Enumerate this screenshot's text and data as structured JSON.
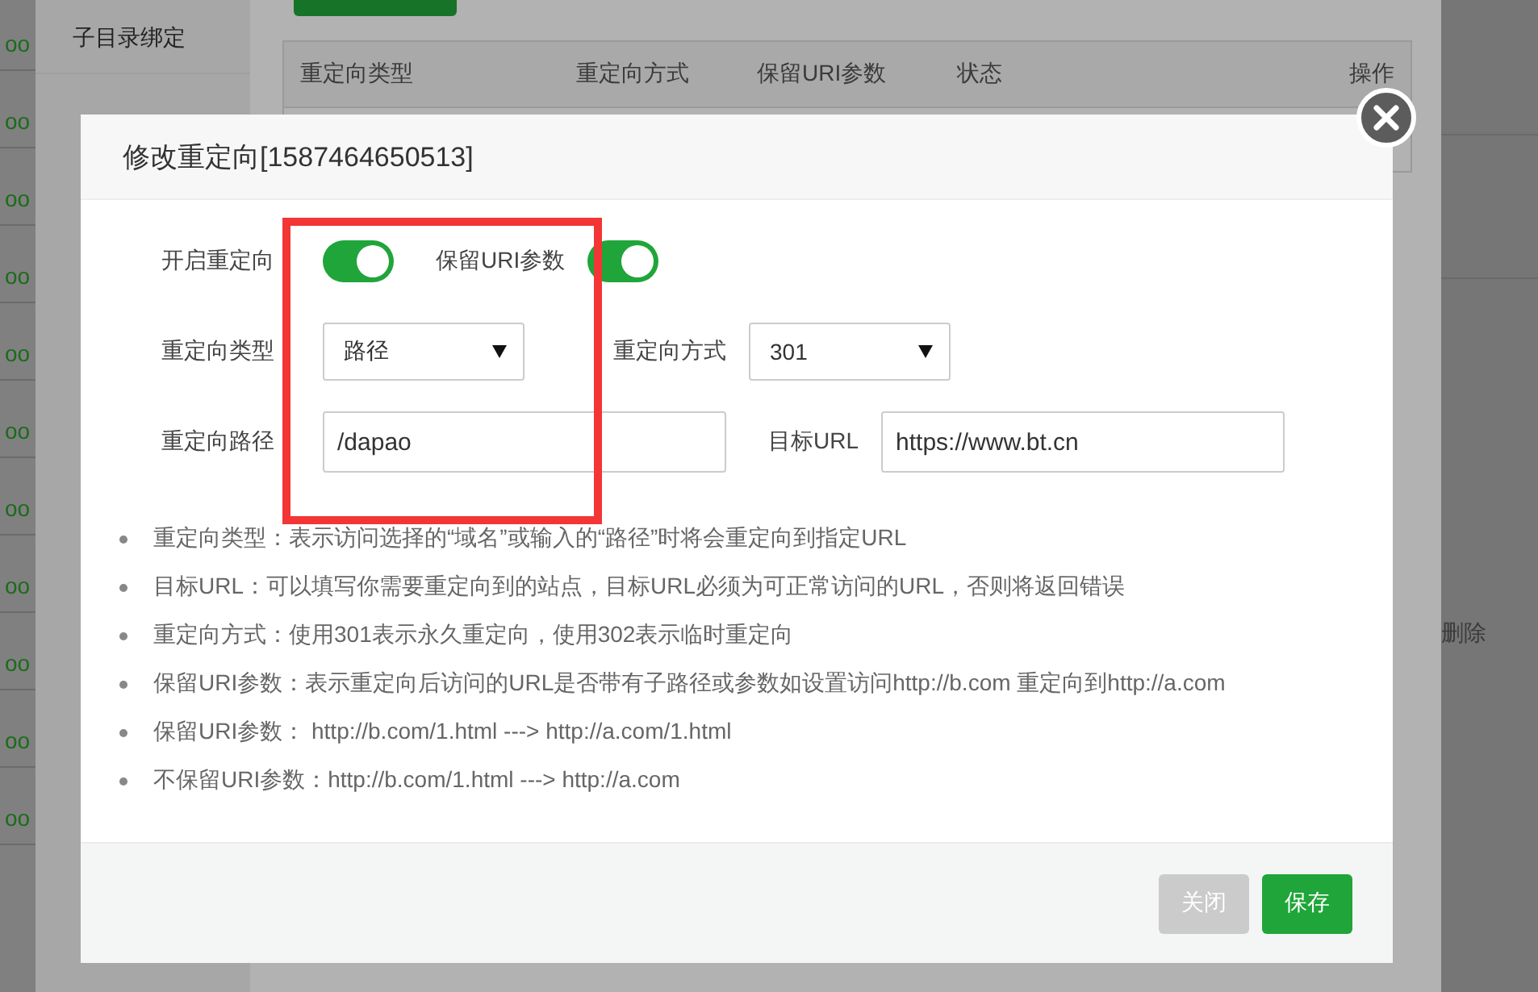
{
  "background": {
    "left_column": [
      "oo",
      "oo",
      "oo",
      "oo",
      "oo",
      "oo",
      "oo",
      "oo",
      "oo",
      "oo",
      "oo"
    ],
    "sidebar": [
      {
        "label": "子目录绑定"
      }
    ],
    "table": {
      "columns": [
        "重定向类型",
        "重定向方式",
        "保留URI参数",
        "状态",
        "操作"
      ]
    },
    "row_action": "删除"
  },
  "dialog": {
    "title": "修改重定向[1587464650513]",
    "fields": [
      {
        "kind": "toggle",
        "label": "开启重定向",
        "on": true
      },
      {
        "kind": "toggle",
        "label": "保留URI参数",
        "on": true
      },
      {
        "kind": "select",
        "label": "重定向类型",
        "value": "路径"
      },
      {
        "kind": "select",
        "label": "重定向方式",
        "value": "301"
      },
      {
        "kind": "input",
        "label": "重定向路径",
        "value": "/dapao"
      },
      {
        "kind": "input",
        "label": "目标URL",
        "value": "https://www.bt.cn"
      }
    ],
    "notes": [
      "重定向类型：表示访问选择的“域名”或输入的“路径”时将会重定向到指定URL",
      "目标URL：可以填写你需要重定向到的站点，目标URL必须为可正常访问的URL，否则将返回错误",
      "重定向方式：使用301表示永久重定向，使用302表示临时重定向",
      "保留URI参数：表示重定向后访问的URL是否带有子路径或参数如设置访问http://b.com 重定向到http://a.com",
      "保留URI参数： http://b.com/1.html ---> http://a.com/1.html",
      "不保留URI参数：http://b.com/1.html ---> http://a.com"
    ],
    "buttons": [
      {
        "label": "关闭",
        "kind": "secondary"
      },
      {
        "label": "保存",
        "kind": "primary"
      }
    ]
  }
}
